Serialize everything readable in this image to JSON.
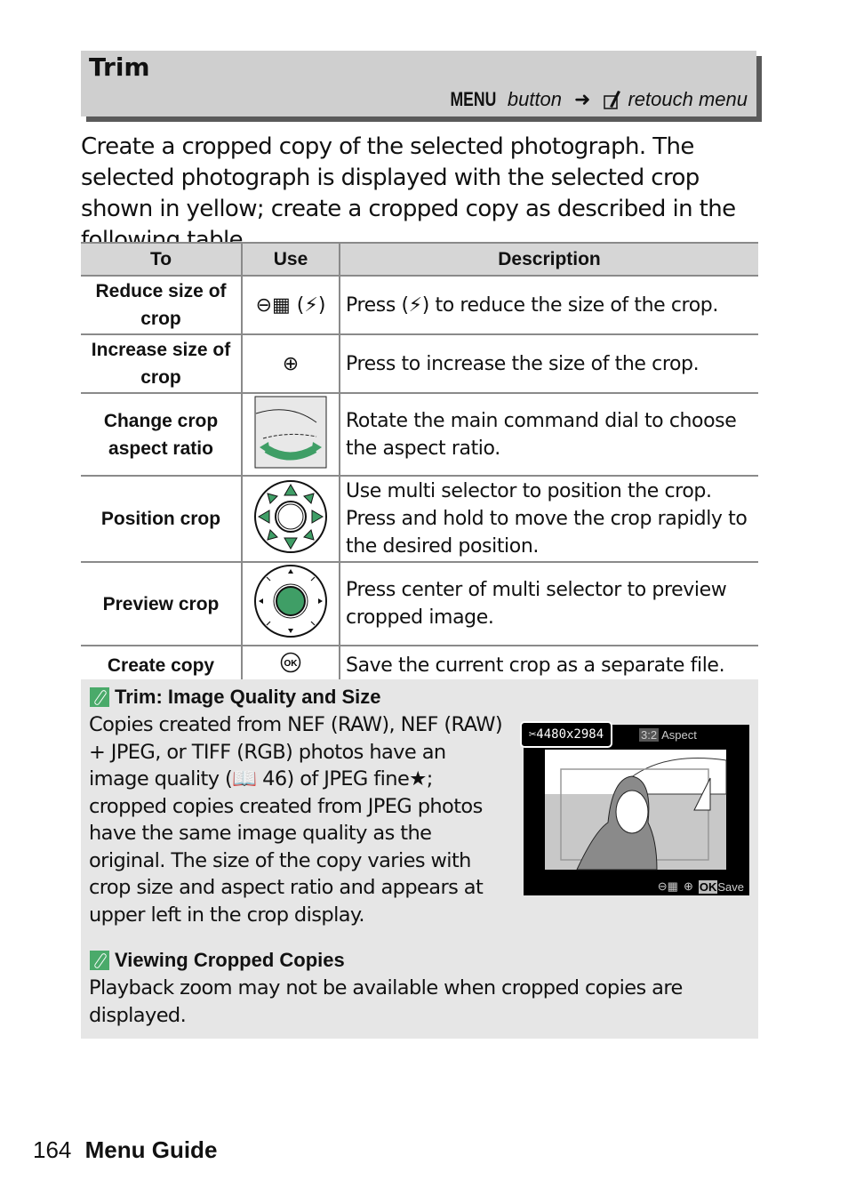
{
  "header": {
    "title": "Trim",
    "menu_key": "MENU",
    "button_word": "button",
    "arrow": "➜",
    "menu_name": "retouch menu"
  },
  "intro": "Create a cropped copy of the selected photograph.  The selected photograph is displayed with the selected crop shown in yellow; create a cropped copy as described in the following table.",
  "table": {
    "headers": [
      "To",
      "Use",
      "Description"
    ],
    "rows": [
      {
        "to": "Reduce size of crop",
        "use": "zoom-out-thumbnail (flash)",
        "use_text": "(⚡)",
        "desc": "Press  (⚡) to reduce the size of the crop."
      },
      {
        "to": "Increase size of crop",
        "use": "zoom-in",
        "desc": "Press  to increase the size of the crop."
      },
      {
        "to": "Change crop aspect ratio",
        "use": "main-command-dial",
        "desc": "Rotate the main command dial to choose the aspect ratio."
      },
      {
        "to": "Position crop",
        "use": "multi-selector-directions",
        "desc": "Use multi selector to position the crop. Press and hold to move the crop rapidly to the desired position."
      },
      {
        "to": "Preview crop",
        "use": "multi-selector-center",
        "desc": "Press center of multi selector to preview cropped image."
      },
      {
        "to": "Create copy",
        "use": "ok-button",
        "desc": "Save the current crop as a separate file."
      }
    ]
  },
  "notes": [
    {
      "title": "Trim: Image Quality and Size",
      "body": "Copies created from NEF (RAW), NEF (RAW) + JPEG, or TIFF (RGB) photos have an image quality (📖 46) of JPEG fine★; cropped copies created from JPEG photos have the same image quality as the original. The size of the copy varies with crop size and aspect ratio and appears at upper left in the crop display."
    },
    {
      "title": "Viewing Cropped Copies",
      "body": "Playback zoom may not be available when cropped copies are displayed."
    }
  ],
  "camera_screen": {
    "size": "4480x2984",
    "ratio": "3:2",
    "aspect_label": "Aspect",
    "save_label": "Save",
    "ok_label": "OK"
  },
  "footer": {
    "page": "164",
    "section": "Menu Guide"
  },
  "colors": {
    "accent_green": "#3f9e66",
    "header_gray": "#cfcfcf",
    "note_gray": "#e6e6e6"
  }
}
